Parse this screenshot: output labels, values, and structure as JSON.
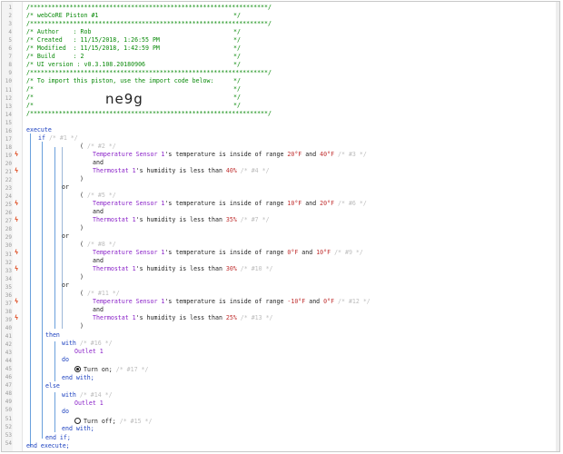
{
  "header": {
    "border": "/******************************************************************/",
    "title": "/* webCoRE Piston #1",
    "sep": "/******************************************************************/",
    "author": "/* Author    : Rob",
    "created": "/* Created   : 11/15/2018, 1:26:55 PM",
    "modified": "/* Modified  : 11/15/2018, 1:42:59 PM",
    "build": "/* Build     : 2",
    "ui": "/* UI version : v0.3.108.20180906",
    "import": "/* To import this piston, use the import code below:",
    "star": "/*",
    "code": "ne9g",
    "end": "*/"
  },
  "lines": [
    "1",
    "2",
    "3",
    "4",
    "5",
    "6",
    "7",
    "8",
    "9",
    "10",
    "11",
    "12",
    "13",
    "14",
    "15",
    "16",
    "17",
    "18",
    "19",
    "20",
    "21",
    "22",
    "23",
    "24",
    "25",
    "26",
    "27",
    "28",
    "29",
    "30",
    "31",
    "32",
    "33",
    "34",
    "35",
    "36",
    "37",
    "38",
    "39",
    "40",
    "41",
    "42",
    "43",
    "44",
    "45",
    "46",
    "47",
    "48",
    "49",
    "50",
    "51",
    "52",
    "53",
    "54"
  ],
  "kw": {
    "execute": "execute",
    "if": "if",
    "or": "or",
    "and": "and",
    "then": "then",
    "else": "else",
    "with": "with",
    "do": "do",
    "end_with": "end with;",
    "end_if": "end if;",
    "end_execute": "end execute;",
    "open": "(",
    "close": ")"
  },
  "cond": {
    "temp_dev": "Temperature Sensor 1",
    "temp_text": "'s temperature is inside of range ",
    "hum_dev": "Thermostat 1",
    "hum_text": "'s humidity is less than ",
    "g1": {
      "lo": "20°F",
      "hi": "40°F",
      "hum": "40%",
      "c_open": "/* #2 */",
      "c_t": "/* #3 */",
      "c_h": "/* #4 */"
    },
    "g2": {
      "lo": "10°F",
      "hi": "20°F",
      "hum": "35%",
      "c_open": "/* #5 */",
      "c_t": "/* #6 */",
      "c_h": "/* #7 */"
    },
    "g3": {
      "lo": "0°F",
      "hi": "10°F",
      "hum": "30%",
      "c_open": "/* #8 */",
      "c_t": "/* #9 */",
      "c_h": "/* #10 */"
    },
    "g4": {
      "lo": "-10°F",
      "hi": "0°F",
      "hum": "25%",
      "c_open": "/* #11 */",
      "c_t": "/* #12 */",
      "c_h": "/* #13 */"
    }
  },
  "and_word": "and",
  "if_comment": "/* #1 */",
  "then_block": {
    "with_comment": "/* #16 */",
    "device": "Outlet 1",
    "action": "Turn on;",
    "action_comment": "/* #17 */"
  },
  "else_block": {
    "with_comment": "/* #14 */",
    "device": "Outlet 1",
    "action": "Turn off;",
    "action_comment": "/* #15 */"
  },
  "marks": {
    "symbol": "ϟ"
  }
}
